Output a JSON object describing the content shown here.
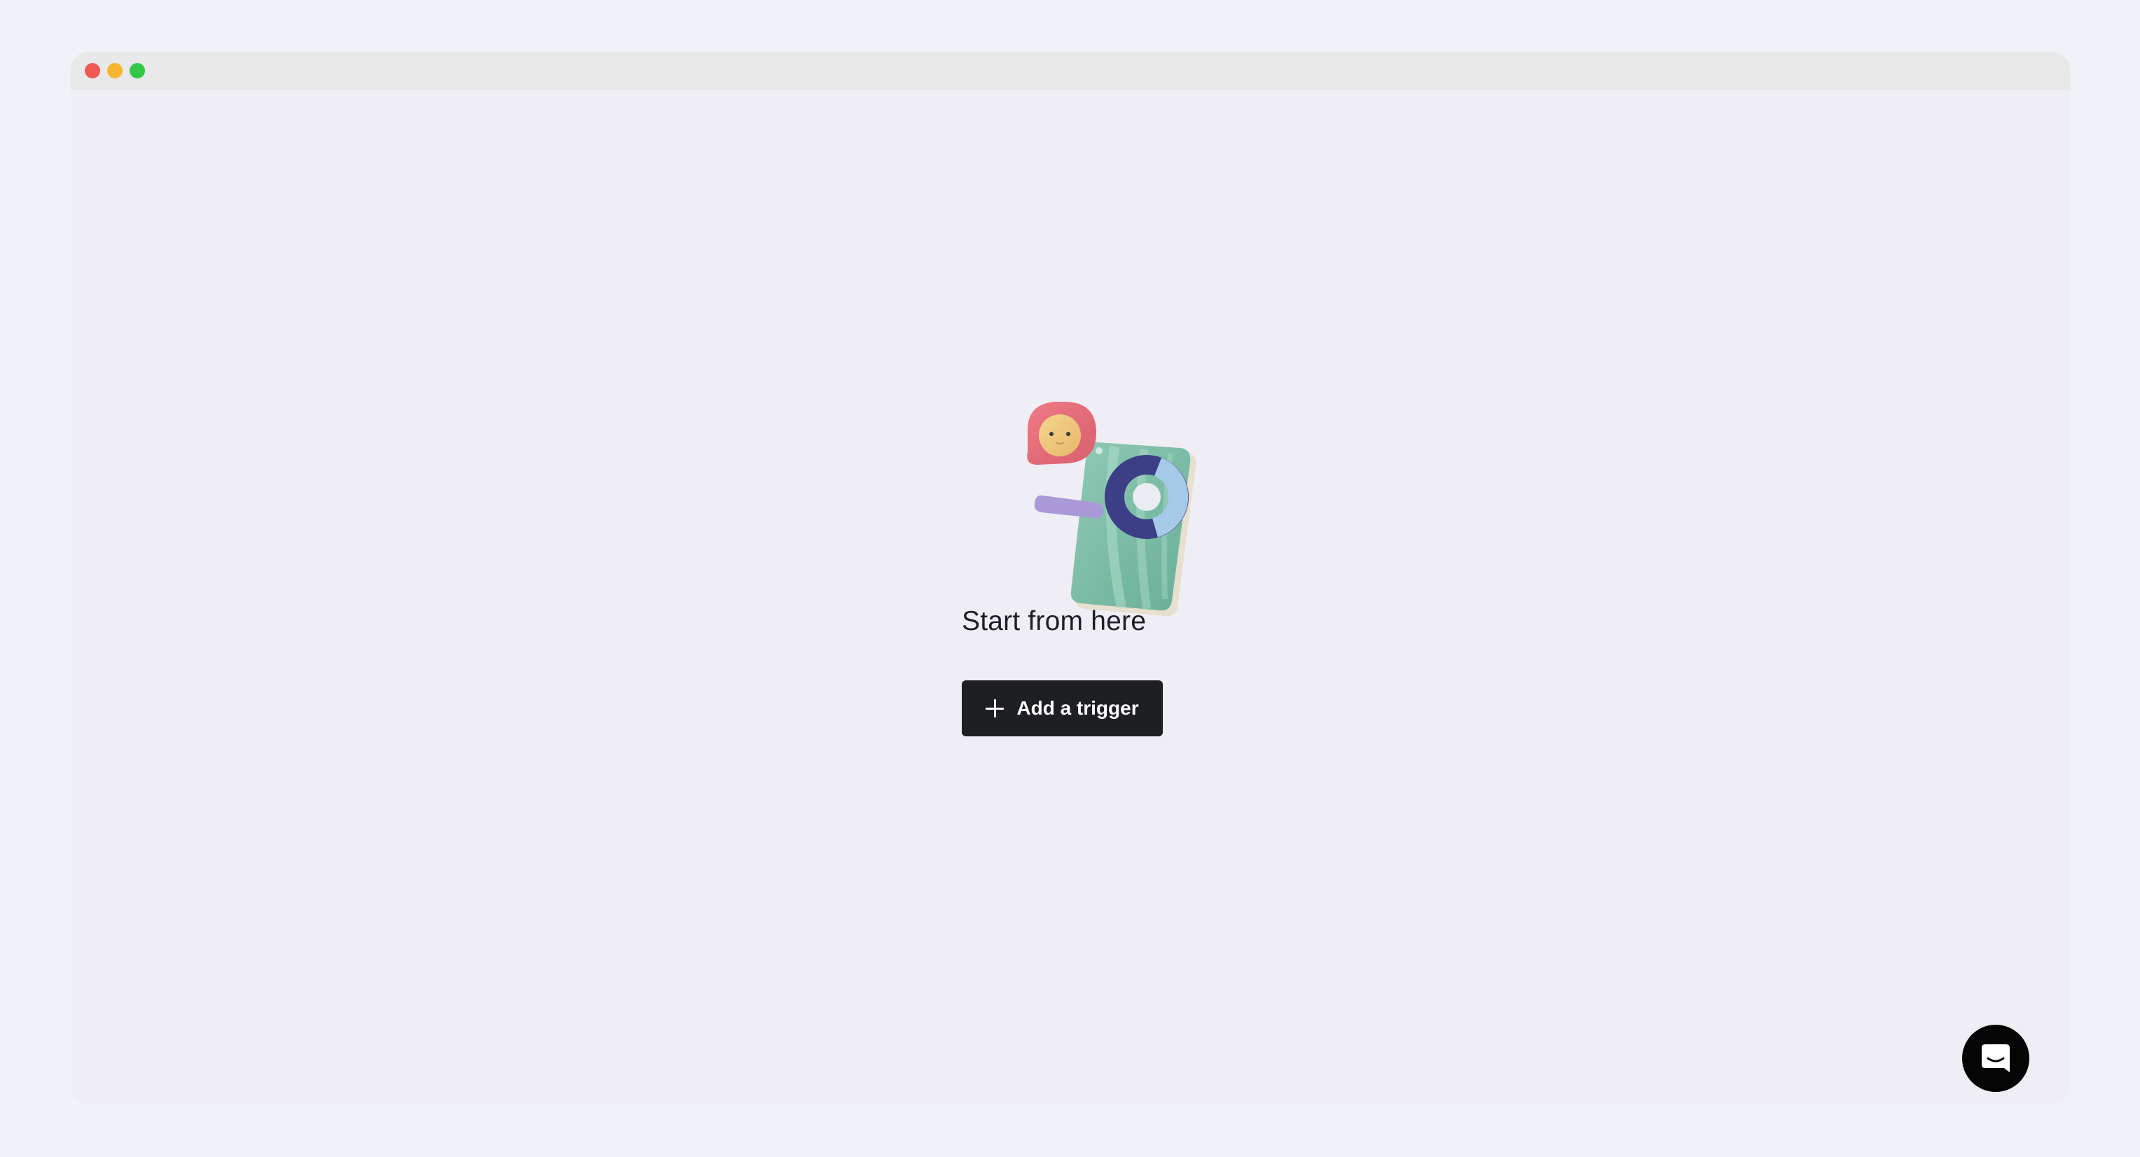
{
  "window": {
    "traffic_lights": {
      "close_color": "#ee5a51",
      "minimize_color": "#f6b531",
      "maximize_color": "#33c748"
    }
  },
  "empty_state": {
    "illustration_icon": "phone-chat-donut-illustration",
    "headline": "Start from here",
    "add_trigger_button": {
      "icon": "plus-icon",
      "label": "Add a trigger"
    }
  },
  "chat_launcher": {
    "icon": "chat-bubble-icon",
    "background_color": "#050505"
  },
  "colors": {
    "page_background": "#eff2f7",
    "window_background": "#efeef4",
    "titlebar_background": "#e8e8e8",
    "button_background": "#1e1f23",
    "text_primary": "#1d1f24"
  }
}
